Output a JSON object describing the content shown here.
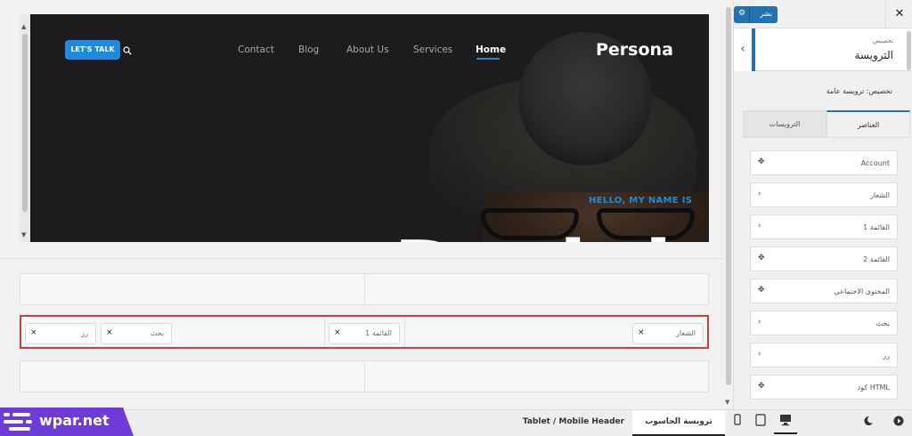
{
  "preview": {
    "cta_label": "LET'S TALK",
    "nav": [
      "Contact",
      "Blog",
      "About Us",
      "Services",
      "Home"
    ],
    "brand": "Persona",
    "hero_kicker": "HELLO, MY NAME IS",
    "hero_bigtext": "Dariel"
  },
  "builder": {
    "main_row_items": [
      "رز",
      "بحث",
      "القائمة 1",
      "الشعار"
    ]
  },
  "bottom": {
    "site_logo": "wpar.net",
    "tablet_tab": "Tablet / Mobile Header",
    "desktop_tab": "ترويسة الحاسوب"
  },
  "sidebar": {
    "publish_label": "نشر",
    "close_label": "✕",
    "breadcrumb": "تخصيص",
    "title": "الترويسة",
    "description": "تخصيص: ترويسة عامة",
    "tab_elements": "العناصر",
    "tab_headers": "الترويسات",
    "elements": [
      {
        "label": "Account",
        "icon": "move-icon"
      },
      {
        "label": "الشعار",
        "icon": "chevron-icon"
      },
      {
        "label": "القائمة 1",
        "icon": "chevron-icon"
      },
      {
        "label": "القائمة 2",
        "icon": "move-icon"
      },
      {
        "label": "المحتوى الاجتماعي",
        "icon": "move-icon"
      },
      {
        "label": "بحث",
        "icon": "chevron-icon"
      },
      {
        "label": "رز",
        "icon": "chevron-icon"
      },
      {
        "label": "كود HTML",
        "icon": "move-icon"
      }
    ]
  },
  "colors": {
    "accent": "#2271b1",
    "cta": "#1a8be0",
    "highlight_border": "#d03d3d",
    "logo_badge": "#6c3bd8"
  }
}
